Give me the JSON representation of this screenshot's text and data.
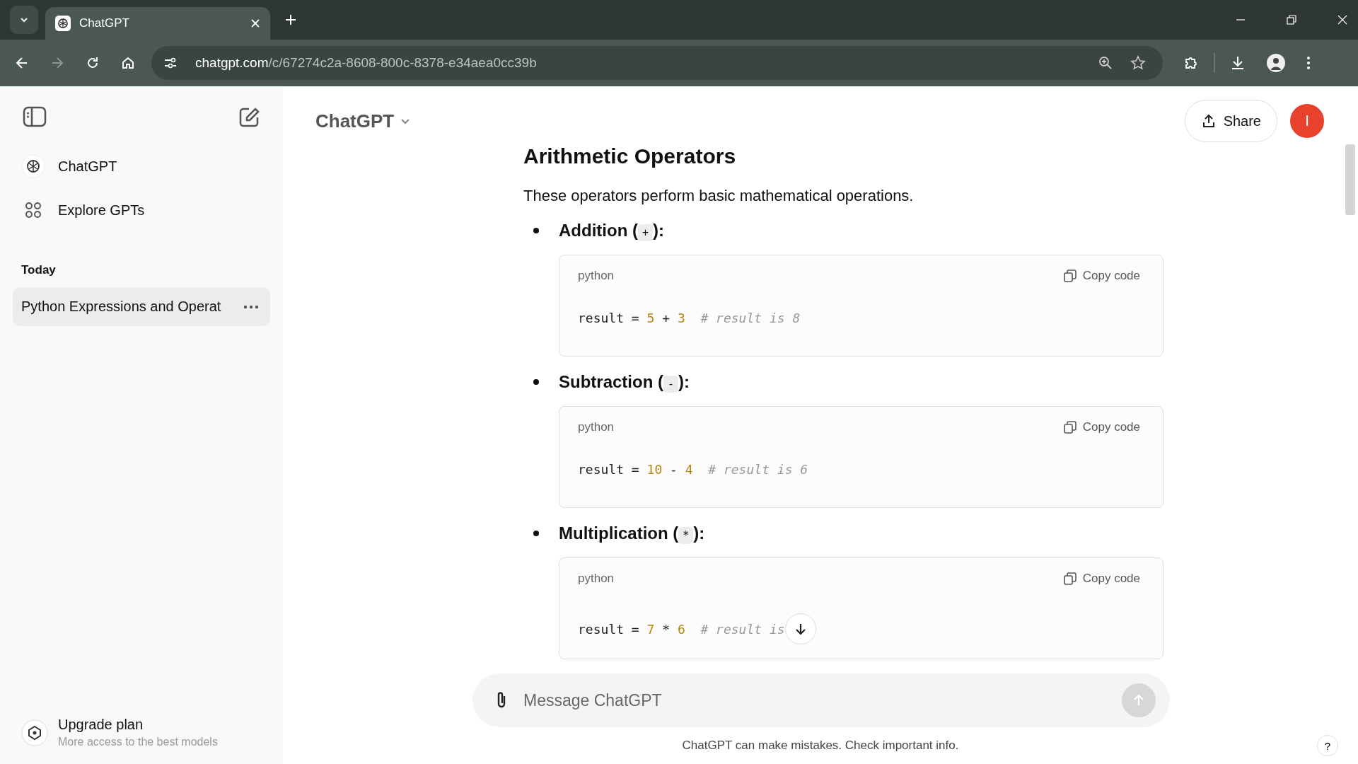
{
  "browser": {
    "tab": {
      "title": "ChatGPT",
      "selected": true
    },
    "url_host": "chatgpt.com",
    "url_path": "/c/67274c2a-8608-800c-8378-e34aea0cc39b"
  },
  "sidebar": {
    "nav": [
      {
        "kind": "logo",
        "label": "ChatGPT"
      },
      {
        "kind": "grid",
        "label": "Explore GPTs"
      }
    ],
    "section_title": "Today",
    "chats": [
      {
        "title": "Python Expressions and Operat",
        "selected": true
      }
    ],
    "upgrade": {
      "title": "Upgrade plan",
      "subtitle": "More access to the best models"
    }
  },
  "header": {
    "model": "ChatGPT",
    "share": "Share",
    "avatar": "I"
  },
  "content": {
    "heading": "Arithmetic Operators",
    "intro": "These operators perform basic mathematical operations.",
    "items": [
      {
        "label": "Addition (",
        "operator": "+",
        "suffix": "):",
        "language": "python",
        "copy": "Copy code",
        "code": [
          {
            "kind": "plain",
            "text": "result = "
          },
          {
            "kind": "number",
            "text": "5"
          },
          {
            "kind": "plain",
            "text": " + "
          },
          {
            "kind": "number",
            "text": "3"
          },
          {
            "kind": "comment",
            "text": "  # result is 8"
          }
        ]
      },
      {
        "label": "Subtraction (",
        "operator": "-",
        "suffix": "):",
        "language": "python",
        "copy": "Copy code",
        "code": [
          {
            "kind": "plain",
            "text": "result = "
          },
          {
            "kind": "number",
            "text": "10"
          },
          {
            "kind": "plain",
            "text": " - "
          },
          {
            "kind": "number",
            "text": "4"
          },
          {
            "kind": "comment",
            "text": "  # result is 6"
          }
        ]
      },
      {
        "label": "Multiplication (",
        "operator": "*",
        "suffix": "):",
        "language": "python",
        "copy": "Copy code",
        "code": [
          {
            "kind": "plain",
            "text": "result = "
          },
          {
            "kind": "number",
            "text": "7"
          },
          {
            "kind": "plain",
            "text": " * "
          },
          {
            "kind": "number",
            "text": "6"
          },
          {
            "kind": "comment",
            "text": "  # result is"
          }
        ]
      }
    ]
  },
  "composer": {
    "placeholder": "Message ChatGPT"
  },
  "footer": "ChatGPT can make mistakes. Check important info.",
  "help": "?"
}
